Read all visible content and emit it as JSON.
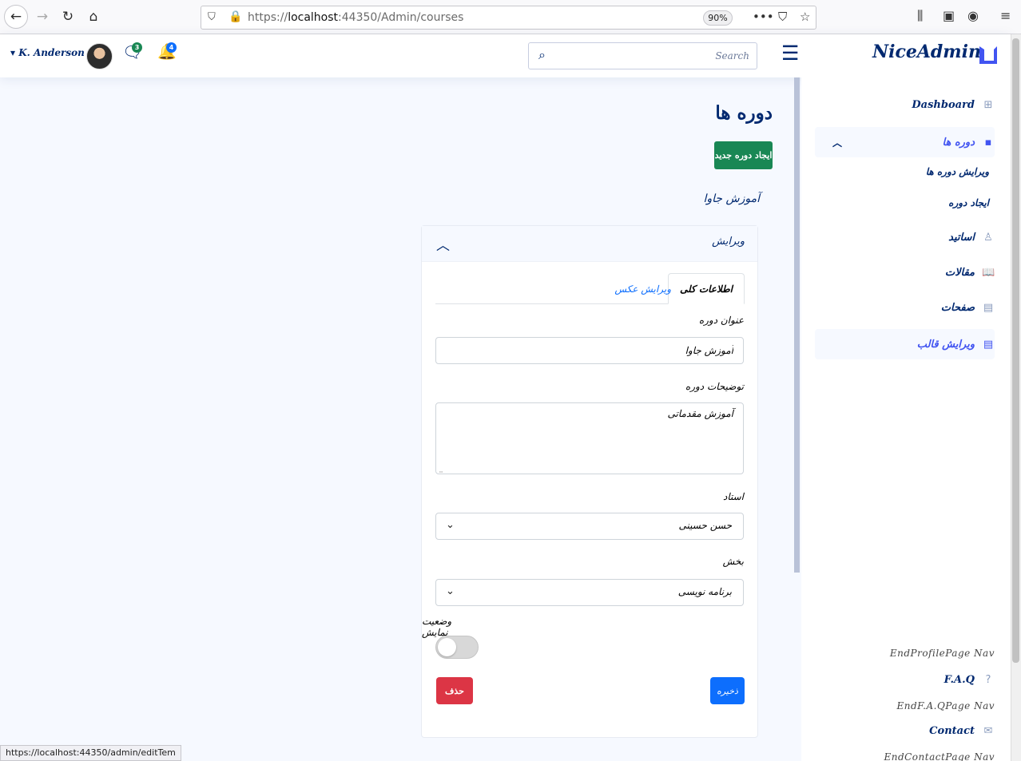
{
  "browser": {
    "url_prefix": "https://",
    "url_host": "localhost",
    "url_path": ":44350/Admin/courses",
    "zoom": "90%",
    "status_url": "https://localhost:44350/admin/editTem"
  },
  "header": {
    "user_name": "K. Anderson",
    "messages_count": "3",
    "notifications_count": "4",
    "search_placeholder": "Search",
    "logo": "NiceAdmin"
  },
  "sidebar": {
    "dashboard": "Dashboard",
    "courses": "دوره ها",
    "edit_courses": "ویرایش دوره ها",
    "create_course": "ایجاد دوره",
    "teachers": "اساتید",
    "articles": "مقالات",
    "pages": "صفحات",
    "edit_template": "ویرایش قالب",
    "end_profile": "EndProfilePage Nav",
    "faq": "F.A.Q",
    "end_faq": "EndF.A.QPage Nav",
    "contact": "Contact",
    "end_contact": "EndContactPage Nav"
  },
  "main": {
    "page_title": "دوره ها",
    "new_course_button": "ایجاد دوره جدید",
    "course_heading": "آموزش جاوا",
    "accordion_title": "ویرایش",
    "tabs": [
      "اطلاعات کلی",
      "ویرایش عکس"
    ],
    "form": {
      "title_label": "عنوان دوره",
      "title_value": "آموزش جاوا",
      "description_label": "توضیحات دوره",
      "description_value": "آموزش مقدماتی",
      "teacher_label": "استاد",
      "teacher_value": "حسن حسینی",
      "section_label": "بخش",
      "section_value": "برنامه نویسی",
      "visibility_label": "وضعیت نمایش",
      "visibility_on": false,
      "save_button": "ذخیره",
      "delete_button": "حذف"
    }
  },
  "colors": {
    "primary": "#4154f1",
    "navy": "#012970",
    "success": "#198754",
    "danger": "#dc3545",
    "blue": "#0d6efd"
  }
}
